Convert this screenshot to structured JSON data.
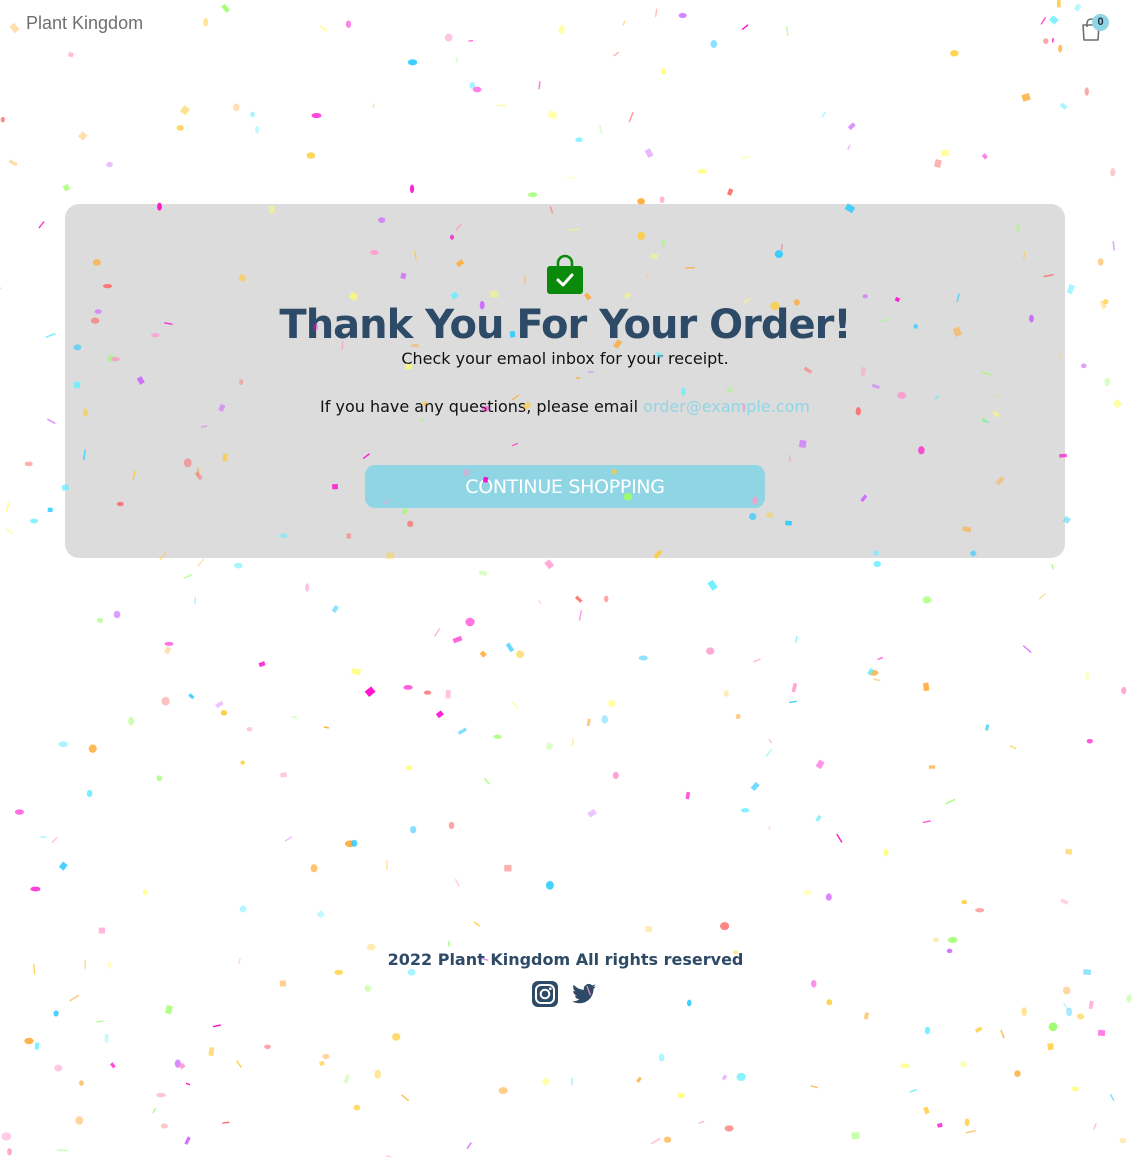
{
  "header": {
    "brand": "Plant Kingdom",
    "cart_count": "0"
  },
  "confirmation": {
    "title": "Thank You For Your Order!",
    "subtitle": "Check your emaol inbox for your receipt.",
    "questions_prefix": "If you have any questions, please email",
    "email": "order@example.com",
    "cta_label": "Continue Shopping"
  },
  "footer": {
    "copyright": "2022 Plant Kingdom All rights reserved"
  },
  "colors": {
    "card_bg": "#dcdcdc",
    "title": "#2d4a67",
    "accent": "#90d5e4",
    "success_icon": "#0a8a0a"
  },
  "icons": [
    "shopping-bag-icon",
    "shopping-bag-check-icon",
    "instagram-icon",
    "twitter-icon"
  ]
}
